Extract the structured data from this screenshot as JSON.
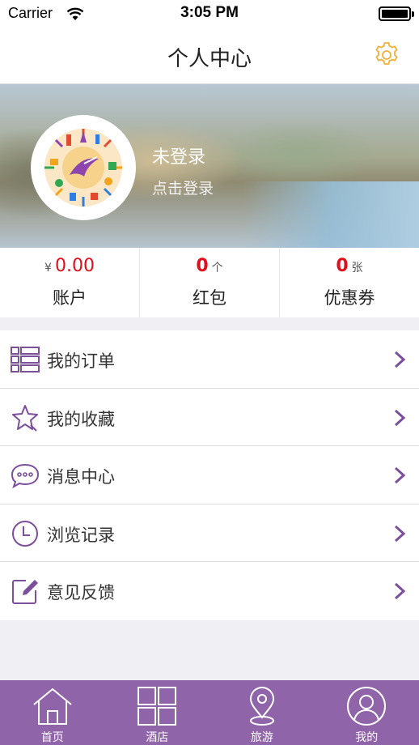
{
  "status_bar": {
    "carrier": "Carrier",
    "time": "3:05 PM"
  },
  "header": {
    "title": "个人中心",
    "settings_icon": "gear-icon",
    "accent_color": "#f0b03c"
  },
  "profile": {
    "username": "未登录",
    "login_prompt": "点击登录"
  },
  "stats": [
    {
      "prefix": "¥",
      "value": "0.00",
      "unit": "",
      "label": "账户"
    },
    {
      "prefix": "",
      "value": "0",
      "unit": "个",
      "label": "红包"
    },
    {
      "prefix": "",
      "value": "0",
      "unit": "张",
      "label": "优惠券"
    }
  ],
  "menu": [
    {
      "label": "我的订单",
      "icon": "list-icon"
    },
    {
      "label": "我的收藏",
      "icon": "star-icon"
    },
    {
      "label": "消息中心",
      "icon": "chat-bubble-icon"
    },
    {
      "label": "浏览记录",
      "icon": "clock-icon"
    },
    {
      "label": "意见反馈",
      "icon": "edit-icon"
    }
  ],
  "tab_bar": {
    "background_color": "#9064a9",
    "tabs": [
      {
        "label": "首页",
        "icon": "home-icon"
      },
      {
        "label": "酒店",
        "icon": "grid-icon"
      },
      {
        "label": "旅游",
        "icon": "location-pin-icon"
      },
      {
        "label": "我的",
        "icon": "user-icon"
      }
    ]
  },
  "colors": {
    "menu_icon": "#7b4f9c",
    "stat_value": "#e0101a"
  }
}
